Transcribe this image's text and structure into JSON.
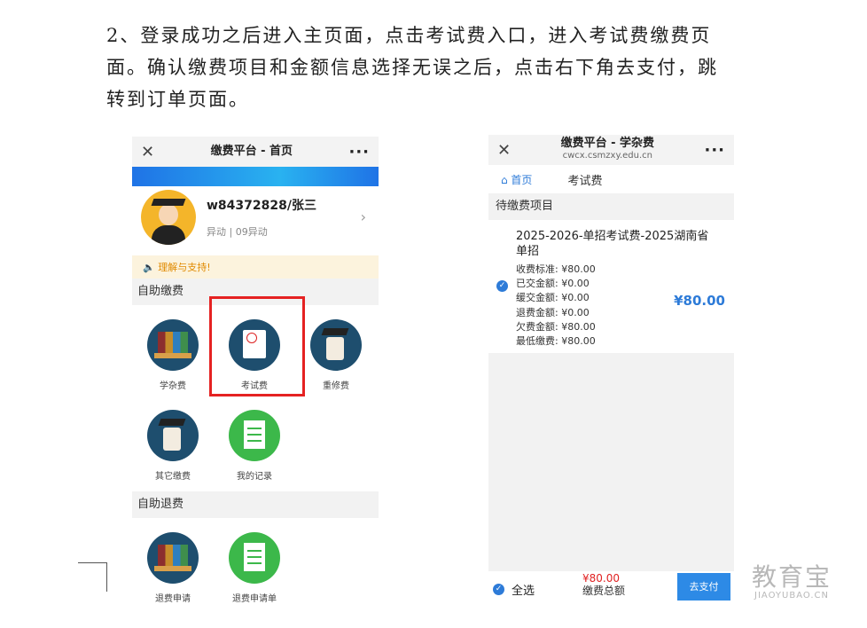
{
  "instructions": {
    "line1": "2、登录成功之后进入主页面，点击考试费入口，进入考试费缴费页",
    "line2": "面。确认缴费项目和金额信息选择无误之后，点击右下角去支付，跳",
    "line3": "转到订单页面。"
  },
  "left_screen": {
    "title": "缴费平台 - 首页",
    "close_icon": "✕",
    "more_icon": "···",
    "user_name": "w84372828/张三",
    "user_desc": "异动 | 09异动",
    "notice": "🔈 理解与支持!",
    "section_self_pay": "自助缴费",
    "pay_items": [
      {
        "label": "学杂费",
        "icon": "books-icon"
      },
      {
        "label": "考试费",
        "icon": "exam-paper-icon"
      },
      {
        "label": "重修费",
        "icon": "diploma-icon"
      },
      {
        "label": "其它缴费",
        "icon": "diploma-icon"
      },
      {
        "label": "我的记录",
        "icon": "checklist-icon"
      }
    ],
    "section_refund": "自助退费",
    "refund_items": [
      {
        "label": "退费申请",
        "icon": "books-icon"
      },
      {
        "label": "退费申请单",
        "icon": "checklist-icon"
      }
    ]
  },
  "right_screen": {
    "title": "缴费平台 - 学杂费",
    "url": "cwcx.csmzxy.edu.cn",
    "home_link": "⌂ 首页",
    "page_title": "考试费",
    "pending_header": "待缴费项目",
    "item_name": "2025-2026-单招考试费-2025湖南省单招",
    "details": [
      "收费标准: ¥80.00",
      "已交金额: ¥0.00",
      "缓交金额: ¥0.00",
      "退费金额: ¥0.00",
      "欠费金额: ¥80.00",
      "最低缴费: ¥80.00"
    ],
    "item_amount": "¥80.00",
    "select_all": "全选",
    "total_value": "¥80.00",
    "total_label": "缴费总额",
    "pay_button": "去支付"
  },
  "watermark": {
    "big": "教育宝",
    "small": "JIAOYUBAO.CN"
  },
  "colors": {
    "accent": "#2d7bd8",
    "highlight": "#e52222",
    "price": "#e02020"
  }
}
